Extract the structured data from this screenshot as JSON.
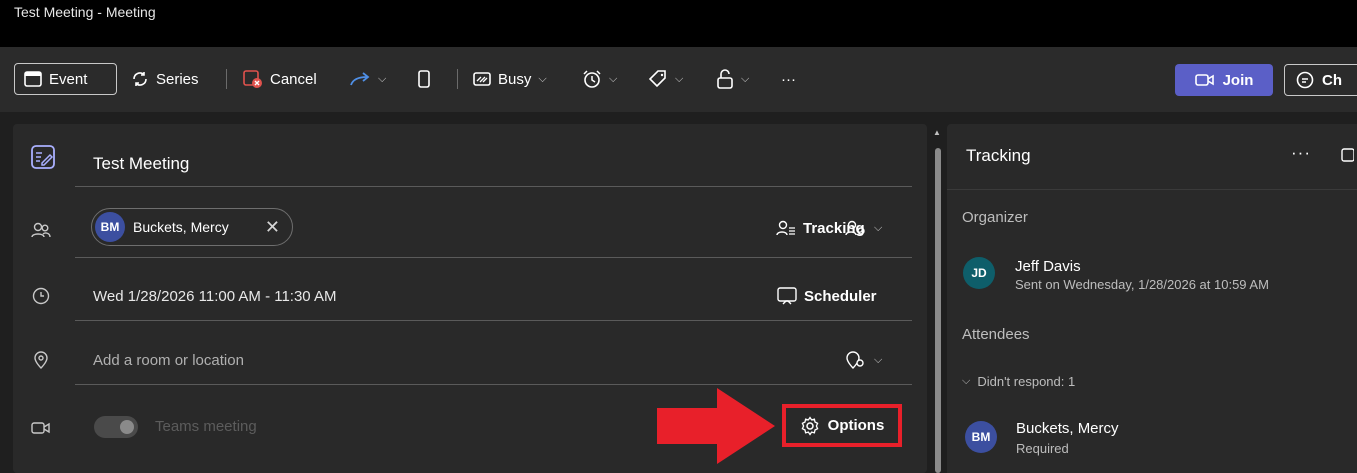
{
  "window": {
    "title": "Test Meeting - Meeting"
  },
  "toolbar": {
    "event_label": "Event",
    "series_label": "Series",
    "cancel_label": "Cancel",
    "busy_label": "Busy",
    "more_label": "···",
    "join_label": "Join",
    "chat_label": "Ch"
  },
  "form": {
    "title": "Test Meeting",
    "attendee": {
      "initials": "BM",
      "name": "Buckets, Mercy"
    },
    "tracking_label": "Tracking",
    "datetime": "Wed 1/28/2026 11:00 AM - 11:30 AM",
    "scheduler_label": "Scheduler",
    "location_placeholder": "Add a room or location",
    "teams_label": "Teams meeting",
    "options_label": "Options"
  },
  "tracking_panel": {
    "title": "Tracking",
    "more_label": "···",
    "organizer_label": "Organizer",
    "organizer": {
      "initials": "JD",
      "name": "Jeff Davis",
      "detail": "Sent on Wednesday, 1/28/2026 at 10:59 AM"
    },
    "attendees_label": "Attendees",
    "didnt_respond_label": "Didn't respond: 1",
    "attendee": {
      "initials": "BM",
      "name": "Buckets, Mercy",
      "role": "Required"
    }
  },
  "colors": {
    "accent": "#5b5fc7",
    "highlight": "#e8202a",
    "cancel_icon": "#e0524d",
    "forward_icon": "#4f8fe6"
  }
}
